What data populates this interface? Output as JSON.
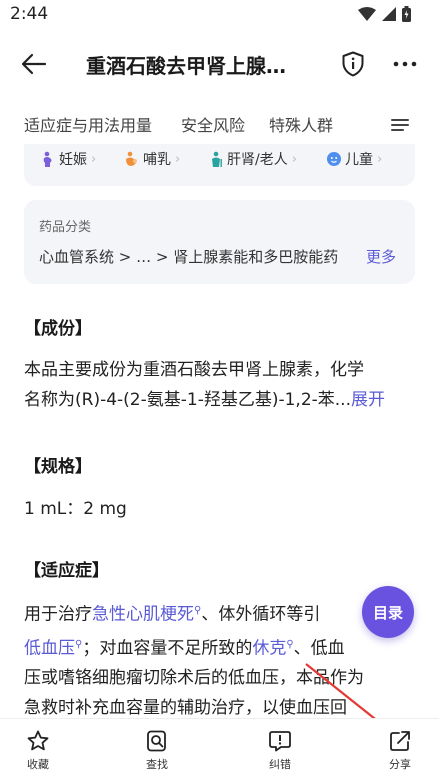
{
  "status_bar": {
    "time": "2:44",
    "icons": [
      "wifi-icon",
      "signal-icon",
      "battery-icon"
    ]
  },
  "header": {
    "title": "重酒石酸去甲肾上腺…",
    "icons": [
      "back-arrow-icon",
      "shield-info-icon",
      "more-dots-icon"
    ]
  },
  "tabs": [
    {
      "label": "适应症与用法用量"
    },
    {
      "label": "安全风险"
    },
    {
      "label": "特殊人群"
    }
  ],
  "population": [
    {
      "label": "妊娠",
      "icon": "pregnant-icon"
    },
    {
      "label": "哺乳",
      "icon": "breastfeeding-icon"
    },
    {
      "label": "肝肾/老人",
      "icon": "elderly-icon"
    },
    {
      "label": "儿童",
      "icon": "child-icon"
    }
  ],
  "category": {
    "title": "药品分类",
    "path": "心血管系统 > … > 肾上腺素能和多巴胺能药",
    "more": "更多"
  },
  "sections": {
    "ingredients": {
      "heading": "【成份】",
      "line1": "本品主要成份为重酒石酸去甲肾上腺素，化学",
      "line2": "名称为(R)-4-(2-氨基-1-羟基乙基)-1,2-苯...",
      "expand": "展开"
    },
    "spec": {
      "heading": "【规格】",
      "text": "1 mL：2 mg"
    },
    "indication": {
      "heading": "【适应症】",
      "l1_a": "用于治疗",
      "l1_link": "急性心肌梗死",
      "l1_b": "、体外循环等引",
      "l2_link": "低血压",
      "l2_b": "；对血容量不足所致的",
      "l2_link2": "休克",
      "l2_c": "、低血",
      "line3": "压或嗜铬细胞瘤切除术后的低血压，本品作为",
      "line4": "急救时补充血容量的辅助治疗，以使血压回"
    }
  },
  "toc_button": "目录",
  "bottom_bar": [
    {
      "label": "收藏",
      "icon": "star-icon"
    },
    {
      "label": "查找",
      "icon": "search-doc-icon"
    },
    {
      "label": "纠错",
      "icon": "feedback-icon"
    },
    {
      "label": "分享",
      "icon": "share-icon"
    }
  ],
  "colors": {
    "accent": "#5b5bd6",
    "fab": "#6a52e0",
    "annotation_arrow": "#e53935"
  }
}
